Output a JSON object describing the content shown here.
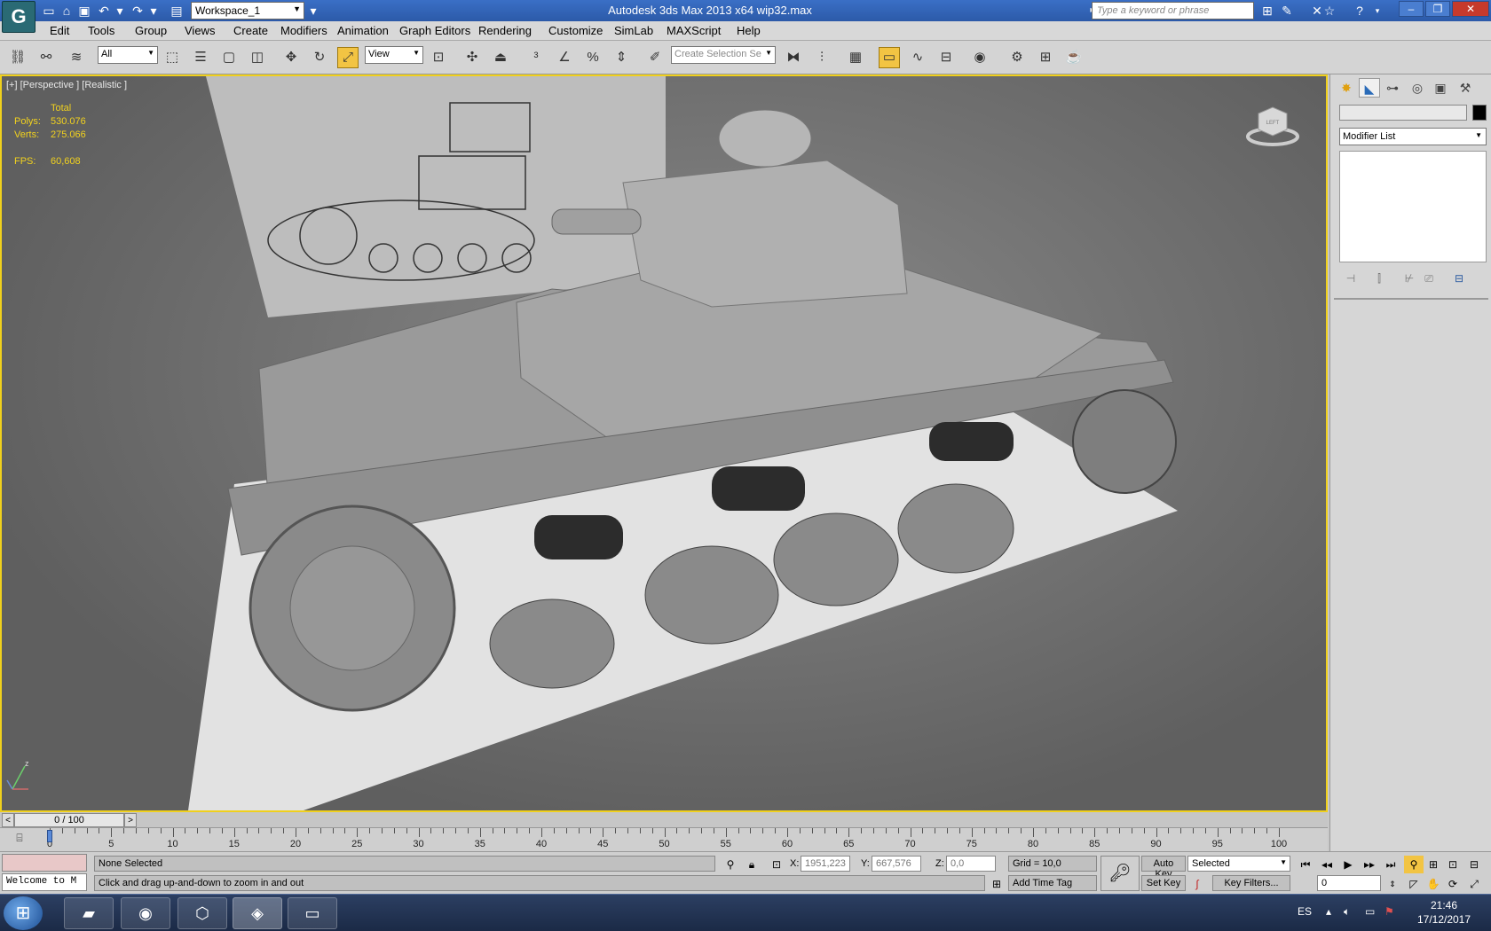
{
  "titlebar": {
    "title": "Autodesk 3ds Max  2013 x64     wip32.max",
    "workspace": "Workspace_1",
    "search_placeholder": "Type a keyword or phrase",
    "logo": "G"
  },
  "menu": [
    "Edit",
    "Tools",
    "Group",
    "Views",
    "Create",
    "Modifiers",
    "Animation",
    "Graph Editors",
    "Rendering",
    "Customize",
    "SimLab",
    "MAXScript",
    "Help"
  ],
  "toolbar": {
    "filter_select": "All",
    "refcoord_select": "View",
    "selection_set_placeholder": "Create Selection Se",
    "icons": [
      "link-icon",
      "unlink-icon",
      "bind-space-warp-icon",
      "select-object-icon",
      "select-by-name-icon",
      "rect-region-icon",
      "window-crossing-icon",
      "move-icon",
      "rotate-icon",
      "scale-icon",
      "pivot-icon",
      "manipulate-icon",
      "snap-3d-icon",
      "angle-snap-icon",
      "percent-snap-icon",
      "spinner-snap-icon",
      "edit-named-sets-icon",
      "mirror-icon",
      "align-icon",
      "layer-manager-icon",
      "graphite-ribbon-icon",
      "curve-editor-icon",
      "schematic-view-icon",
      "material-editor-icon",
      "render-setup-icon",
      "rendered-frame-icon",
      "render-production-icon"
    ]
  },
  "viewport": {
    "label": "[+] [Perspective ] [Realistic ]",
    "stats": {
      "total_label": "Total",
      "polys_label": "Polys:",
      "polys_value": "530.076",
      "verts_label": "Verts:",
      "verts_value": "275.066",
      "fps_label": "FPS:",
      "fps_value": "60,608"
    },
    "viewcube_label": "LEFT",
    "axis_z": "z"
  },
  "command_panel": {
    "tabs": [
      "create-tab",
      "modify-tab",
      "hierarchy-tab",
      "motion-tab",
      "display-tab",
      "utilities-tab"
    ],
    "modifier_list": "Modifier List"
  },
  "timeslider": {
    "position": "0 / 100",
    "left": "<",
    "right": ">"
  },
  "trackbar": {
    "labels": [
      "0",
      "5",
      "10",
      "15",
      "20",
      "25",
      "30",
      "35",
      "40",
      "45",
      "50",
      "55",
      "60",
      "65",
      "70",
      "75",
      "80",
      "85",
      "90",
      "95",
      "100"
    ]
  },
  "status": {
    "maxscript_listener": "Welcome to M",
    "selection": "None Selected",
    "prompt": "Click and drag up-and-down to zoom in and out",
    "x_label": "X:",
    "x_value": "1951,223",
    "y_label": "Y:",
    "y_value": "667,576",
    "z_label": "Z:",
    "z_value": "0,0",
    "grid": "Grid = 10,0",
    "add_time_tag": "Add Time Tag",
    "auto_key": "Auto Key",
    "set_key": "Set Key",
    "selected_dropdown": "Selected",
    "key_filters": "Key Filters...",
    "frame_value": "0"
  },
  "taskbar": {
    "language": "ES",
    "time": "21:46",
    "date": "17/12/2017"
  },
  "colors": {
    "accent_active": "#f2c443",
    "viewport_border": "#f0d01c",
    "stat_text": "#f2d21e",
    "titlebar": "#2c5aa8"
  }
}
